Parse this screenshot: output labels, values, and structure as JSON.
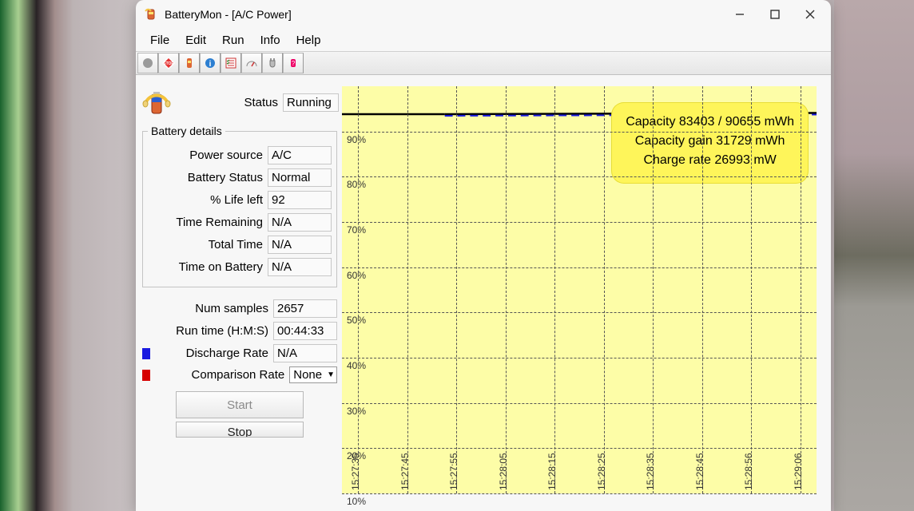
{
  "window": {
    "title": "BatteryMon - [A/C Power]"
  },
  "menu": [
    "File",
    "Edit",
    "Run",
    "Info",
    "Help"
  ],
  "toolbar_icons": [
    "record",
    "stop",
    "battery",
    "info-small",
    "checklist",
    "gauge",
    "plug",
    "config"
  ],
  "status": {
    "label": "Status",
    "value": "Running"
  },
  "details": {
    "legend": "Battery details",
    "rows": [
      {
        "label": "Power source",
        "value": "A/C"
      },
      {
        "label": "Battery Status",
        "value": "Normal"
      },
      {
        "label": "% Life left",
        "value": "92"
      },
      {
        "label": "Time Remaining",
        "value": "N/A"
      },
      {
        "label": "Total Time",
        "value": "N/A"
      },
      {
        "label": "Time on Battery",
        "value": "N/A"
      }
    ]
  },
  "extra": {
    "rows": [
      {
        "label": "Num samples",
        "value": "2657"
      },
      {
        "label": "Run time (H:M:S)",
        "value": "00:44:33"
      },
      {
        "label": "Discharge Rate",
        "value": "N/A",
        "swatch": "blue"
      },
      {
        "label": "Comparison Rate",
        "value": "None",
        "swatch": "red",
        "combo": true
      }
    ]
  },
  "buttons": {
    "start": "Start",
    "stop": "Stop"
  },
  "chart_data": {
    "type": "line",
    "ylabel_percent": true,
    "ylim": [
      10,
      90
    ],
    "y_ticks": [
      90,
      80,
      70,
      60,
      50,
      40,
      30,
      20,
      10
    ],
    "x_ticks": [
      "15:27:35",
      "15:27:45",
      "15:27:55",
      "15:28:05",
      "15:28:15",
      "15:28:25",
      "15:28:35",
      "15:28:45",
      "15:28:56",
      "15:29:06"
    ],
    "series": [
      {
        "name": "charge",
        "approx_value": 92
      }
    ],
    "overlay": {
      "capacity": "Capacity 83403 / 90655 mWh",
      "capacity_gain": "Capacity gain 31729 mWh",
      "charge_rate": "Charge rate 26993 mW"
    }
  }
}
